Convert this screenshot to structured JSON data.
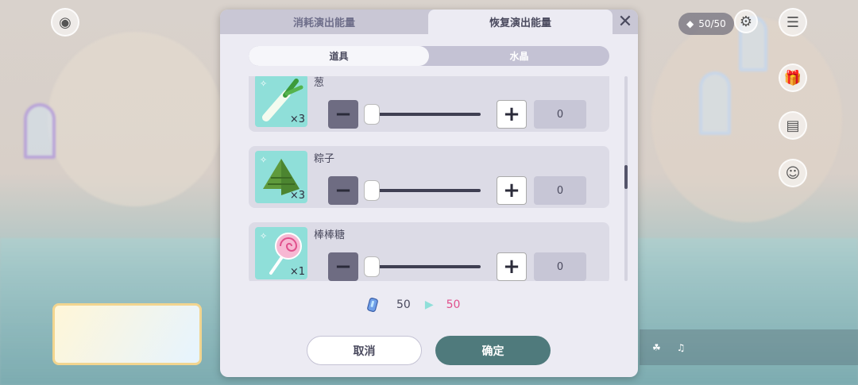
{
  "dialog": {
    "tabs": [
      {
        "label": "消耗演出能量",
        "active": false
      },
      {
        "label": "恢复演出能量",
        "active": true
      }
    ],
    "close_icon": "close-icon",
    "subtabs": [
      {
        "label": "道具",
        "active": true
      },
      {
        "label": "水晶",
        "active": false
      }
    ],
    "items": [
      {
        "name": "葱",
        "quantity": "×3",
        "value": "0",
        "icon": "leek-icon"
      },
      {
        "name": "粽子",
        "quantity": "×3",
        "value": "0",
        "icon": "zongzi-icon"
      },
      {
        "name": "棒棒糖",
        "quantity": "×1",
        "value": "0",
        "icon": "lollipop-icon"
      }
    ],
    "energy": {
      "from": "50",
      "to": "50",
      "icon": "energy-crystal-icon"
    },
    "buttons": {
      "cancel": "取消",
      "confirm": "确定"
    }
  },
  "hud": {
    "energy_count": "50/50"
  },
  "colors": {
    "accent": "#4f7a7c",
    "highlight": "#e0508c",
    "item_bg": "#8fdfd9"
  }
}
